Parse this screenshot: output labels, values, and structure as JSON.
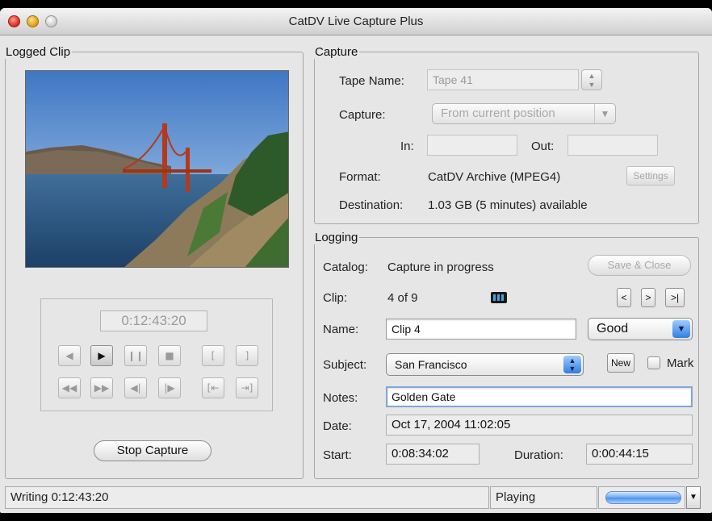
{
  "window": {
    "title": "CatDV Live Capture Plus"
  },
  "logged_clip": {
    "title": "Logged Clip",
    "timecode": "0:12:43:20",
    "transport_row1": [
      "◀",
      "▶",
      "❙❙",
      "■",
      "[",
      "]"
    ],
    "transport_row2": [
      "◀◀",
      "▶▶",
      "◀|",
      "|▶",
      "[⇤",
      "⇥]"
    ],
    "stop_button": "Stop Capture"
  },
  "capture": {
    "title": "Capture",
    "tape_name_label": "Tape Name:",
    "tape_name_value": "Tape 41",
    "capture_label": "Capture:",
    "capture_value": "From current position",
    "in_label": "In:",
    "out_label": "Out:",
    "format_label": "Format:",
    "format_value": "CatDV Archive (MPEG4)",
    "settings_button": "Settings",
    "destination_label": "Destination:",
    "destination_value": "1.03 GB (5 minutes) available"
  },
  "logging": {
    "title": "Logging",
    "catalog_label": "Catalog:",
    "catalog_value": "Capture in progress",
    "save_close_button": "Save & Close",
    "clip_label": "Clip:",
    "clip_value": "4 of 9",
    "nav_prev": "<",
    "nav_next": ">",
    "nav_last": ">|",
    "name_label": "Name:",
    "name_value": "Clip 4",
    "rating_value": "Good",
    "subject_label": "Subject:",
    "subject_value": "San Francisco",
    "new_button": "New",
    "mark_label": "Mark",
    "notes_label": "Notes:",
    "notes_value": "Golden Gate",
    "date_label": "Date:",
    "date_value": "Oct 17, 2004 11:02:05",
    "start_label": "Start:",
    "start_value": "0:08:34:02",
    "duration_label": "Duration:",
    "duration_value": "0:00:44:15"
  },
  "status": {
    "left": "Writing 0:12:43:20",
    "middle": "Playing"
  },
  "icons": [
    "film-icon",
    "stepper-icon",
    "dropdown-arrow-icon",
    "play-icon",
    "pause-icon",
    "stop-icon"
  ]
}
